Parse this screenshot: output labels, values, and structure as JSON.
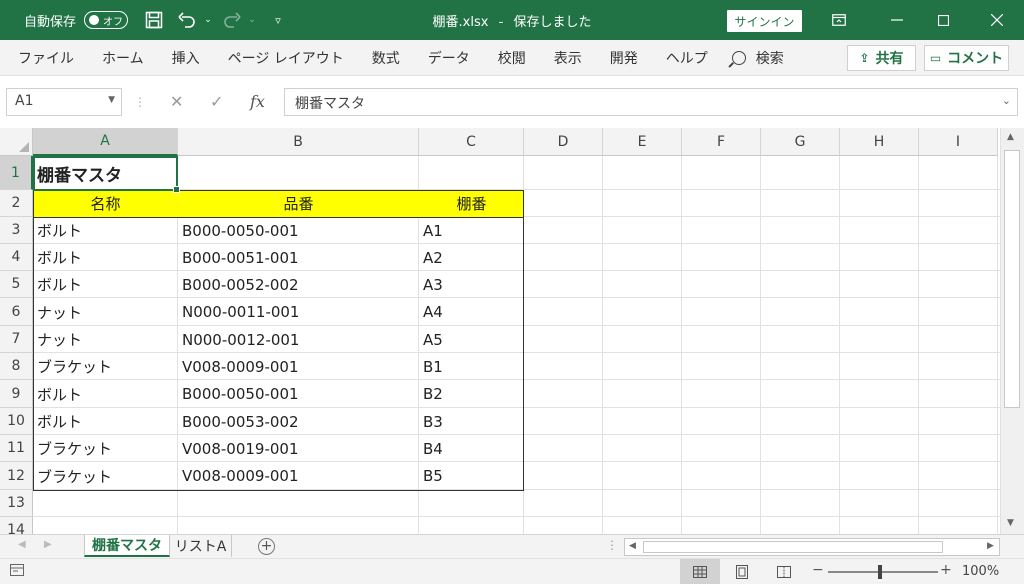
{
  "titlebar": {
    "autosave_label": "自動保存",
    "autosave_state": "オフ",
    "filename": "棚番.xlsx",
    "separator": "-",
    "save_status": "保存しました",
    "signin_label": "サインイン"
  },
  "ribbon": {
    "tabs": [
      "ファイル",
      "ホーム",
      "挿入",
      "ページ レイアウト",
      "数式",
      "データ",
      "校閲",
      "表示",
      "開発",
      "ヘルプ"
    ],
    "search_label": "検索",
    "share_label": "共有",
    "comment_label": "コメント"
  },
  "formula_bar": {
    "name_box": "A1",
    "formula": "棚番マスタ",
    "fx_label": "fx"
  },
  "grid": {
    "columns": [
      "A",
      "B",
      "C",
      "D",
      "E",
      "F",
      "G",
      "H",
      "I"
    ],
    "rows": [
      "1",
      "2",
      "3",
      "4",
      "5",
      "6",
      "7",
      "8",
      "9",
      "10",
      "11",
      "12",
      "13",
      "14"
    ],
    "title": "棚番マスタ",
    "headers": [
      "名称",
      "品番",
      "棚番"
    ],
    "data": [
      [
        "ボルト",
        "B000-0050-001",
        "A1"
      ],
      [
        "ボルト",
        "B000-0051-001",
        "A2"
      ],
      [
        "ボルト",
        "B000-0052-002",
        "A3"
      ],
      [
        "ナット",
        "N000-0011-001",
        "A4"
      ],
      [
        "ナット",
        "N000-0012-001",
        "A5"
      ],
      [
        "ブラケット",
        "V008-0009-001",
        "B1"
      ],
      [
        "ボルト",
        "B000-0050-001",
        "B2"
      ],
      [
        "ボルト",
        "B000-0053-002",
        "B3"
      ],
      [
        "ブラケット",
        "V008-0019-001",
        "B4"
      ],
      [
        "ブラケット",
        "V008-0009-001",
        "B5"
      ]
    ],
    "header_fill_color": "#ffff00",
    "accent_color": "#217346"
  },
  "sheets": {
    "tabs": [
      "棚番マスタ",
      "リストA"
    ],
    "active_index": 0,
    "add_label": "+"
  },
  "statusbar": {
    "zoom": "100%",
    "zoom_minus": "−",
    "zoom_plus": "+"
  }
}
